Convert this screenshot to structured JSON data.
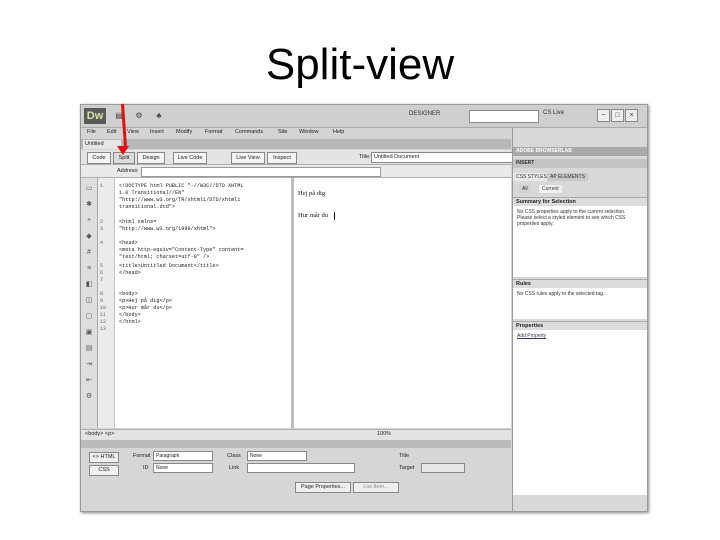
{
  "slide": {
    "title": "Split-view"
  },
  "window": {
    "logo": "Dw",
    "workspace": "DESIGNER",
    "search_placeholder": "",
    "cslive": "CS Live",
    "minimize": "−",
    "maximize": "□",
    "close": "×"
  },
  "menu": [
    "File",
    "Edit",
    "View",
    "Insert",
    "Modify",
    "Format",
    "Commands",
    "Site",
    "Window",
    "Help"
  ],
  "document": {
    "tab_label": "Untitled",
    "view_buttons": {
      "code": "Code",
      "split": "Split",
      "design": "Design",
      "live_code": "Live Code",
      "live_view": "Live View",
      "inspect": "Inspect"
    },
    "title_label": "Title:",
    "title_value": "Untitled Document",
    "address_label": "Address:"
  },
  "code": {
    "line_numbers": [
      "1",
      "",
      "",
      "2",
      "3",
      "",
      "4",
      "",
      "5",
      "6",
      "7",
      "8",
      "9",
      "10",
      "11",
      "12",
      "13"
    ],
    "lines": [
      "<!DOCTYPE html PUBLIC \"-//W3C//DTD XHTML",
      "1.0 Transitional//EN\"",
      "\"http://www.w3.org/TR/xhtml1/DTD/xhtml1",
      "transitional.dtd\">",
      "<html xmlns=",
      "\"http://www.w3.org/1999/xhtml\">",
      "<head>",
      "<meta http-equiv=\"Content-Type\" content=",
      "\"text/html; charset=utf-8\" />",
      "<title>Untitled Document</title>",
      "</head>",
      "",
      "<body>",
      "<p>Hej på dig</p>",
      "<p>Hur mår du</p>",
      "</body>",
      "</html>"
    ]
  },
  "design": {
    "lines": [
      "Hej på dig",
      "Hur mår du"
    ]
  },
  "status": {
    "tags": "<body> <p>",
    "zoom": "100%"
  },
  "properties": {
    "html_btn": "<> HTML",
    "css_btn": "CSS",
    "format_label": "Format",
    "format_value": "Paragraph",
    "class_label": "Class",
    "class_value": "None",
    "id_label": "ID",
    "id_value": "None",
    "link_label": "Link",
    "title_label": "Title",
    "target_label": "Target",
    "page_props": "Page Properties...",
    "list_item": "List Item..."
  },
  "panel": {
    "browserlab": "ADOBE BROWSERLAB",
    "insert": "INSERT",
    "tab_css": "CSS STYLES",
    "tab_ap": "AP ELEMENTS",
    "all": "All",
    "current": "Current",
    "summary_title": "Summary for Selection",
    "summary_text": "No CSS properties apply to the current selection. Please select a styled element to see which CSS properties apply.",
    "rules_title": "Rules",
    "rules_text": "No CSS rules apply to the selected tag.",
    "properties_title": "Properties",
    "add_property": "Add Property"
  }
}
